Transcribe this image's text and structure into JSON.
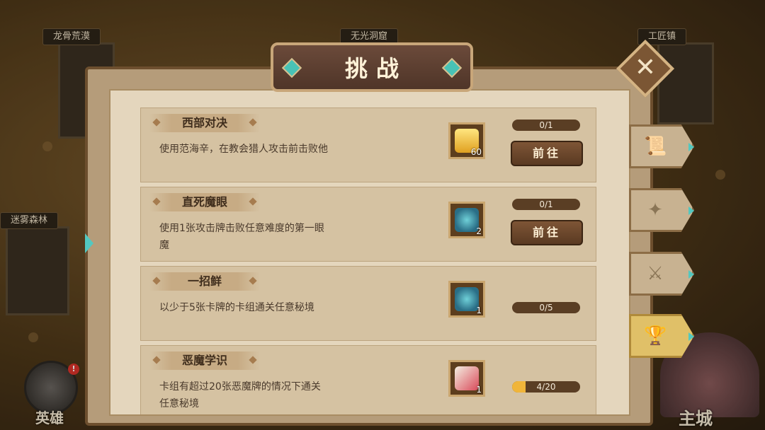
{
  "map": {
    "locations": [
      {
        "name": "龙骨荒漠"
      },
      {
        "name": "无光洞窟"
      },
      {
        "name": "工匠镇"
      },
      {
        "name": "迷雾森林"
      }
    ],
    "hero_label": "英雄",
    "hero_badge": "!",
    "city_label": "主城"
  },
  "dialog": {
    "title": "挑战",
    "close_symbol": "✕"
  },
  "challenges": [
    {
      "title": "西部对决",
      "description": "使用范海辛，在教会猎人攻击前击败他",
      "reward_count": "60",
      "reward_icon": "gem-icon",
      "progress_text": "0/1",
      "progress_fraction": 0,
      "go_label": "前往"
    },
    {
      "title": "直死魔眼",
      "description": "使用1张攻击牌击败任意难度的第一眼魔",
      "reward_count": "2",
      "reward_icon": "potion-icon",
      "progress_text": "0/1",
      "progress_fraction": 0,
      "go_label": "前往"
    },
    {
      "title": "一招鲜",
      "description": "以少于5张卡牌的卡组通关任意秘境",
      "reward_count": "1",
      "reward_icon": "potion-icon",
      "progress_text": "0/5",
      "progress_fraction": 0
    },
    {
      "title": "恶魔学识",
      "description": "卡组有超过20张恶魔牌的情况下通关任意秘境",
      "reward_count": "1",
      "reward_icon": "horn-icon",
      "progress_text": "4/20",
      "progress_fraction": 0.2
    }
  ],
  "side_tabs": [
    {
      "icon": "scroll-icon",
      "glyph": "📜",
      "active": false
    },
    {
      "icon": "book-icon",
      "glyph": "✦",
      "active": false
    },
    {
      "icon": "crossed-swords-icon",
      "glyph": "⚔",
      "active": false
    },
    {
      "icon": "trophy-icon",
      "glyph": "🏆",
      "active": true
    }
  ],
  "colors": {
    "panel_frame": "#6d4f2e",
    "parchment": "#e4d6bd",
    "accent_teal": "#52c8c0",
    "progress_fill": "#f0b53a"
  }
}
